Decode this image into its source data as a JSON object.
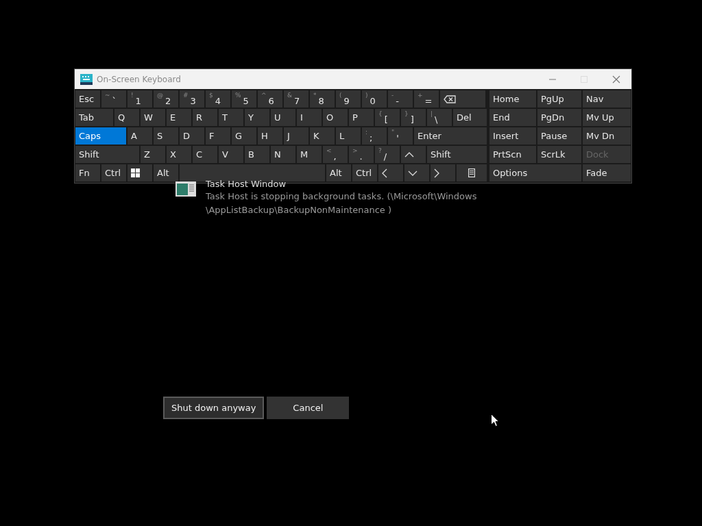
{
  "keyboard_window": {
    "title": "On-Screen Keyboard",
    "maximize_disabled": true,
    "rows": [
      {
        "keys": [
          {
            "kind": "text",
            "label": "Esc",
            "on": false
          },
          {
            "kind": "dual",
            "shift": "~",
            "label": "`",
            "on": false
          },
          {
            "kind": "dual",
            "shift": "!",
            "label": "1",
            "on": false
          },
          {
            "kind": "dual",
            "shift": "@",
            "label": "2",
            "on": false
          },
          {
            "kind": "dual",
            "shift": "#",
            "label": "3",
            "on": false
          },
          {
            "kind": "dual",
            "shift": "$",
            "label": "4",
            "on": false
          },
          {
            "kind": "dual",
            "shift": "%",
            "label": "5",
            "on": false
          },
          {
            "kind": "dual",
            "shift": "^",
            "label": "6",
            "on": false
          },
          {
            "kind": "dual",
            "shift": "&",
            "label": "7",
            "on": false
          },
          {
            "kind": "dual",
            "shift": "*",
            "label": "8",
            "on": false
          },
          {
            "kind": "dual",
            "shift": "(",
            "label": "9",
            "on": false
          },
          {
            "kind": "dual",
            "shift": ")",
            "label": "0",
            "on": false
          },
          {
            "kind": "dual",
            "shift": "-",
            "label": "-",
            "on": false
          },
          {
            "kind": "dual",
            "shift": "+",
            "label": "=",
            "on": false
          },
          {
            "kind": "backspace",
            "on": false
          }
        ]
      },
      {
        "keys": [
          {
            "kind": "text",
            "label": "Tab",
            "on": false
          },
          {
            "kind": "text",
            "label": "Q",
            "on": false
          },
          {
            "kind": "text",
            "label": "W",
            "on": false
          },
          {
            "kind": "text",
            "label": "E",
            "on": false
          },
          {
            "kind": "text",
            "label": "R",
            "on": false
          },
          {
            "kind": "text",
            "label": "T",
            "on": false
          },
          {
            "kind": "text",
            "label": "Y",
            "on": false
          },
          {
            "kind": "text",
            "label": "U",
            "on": false
          },
          {
            "kind": "text",
            "label": "I",
            "on": false
          },
          {
            "kind": "text",
            "label": "O",
            "on": false
          },
          {
            "kind": "text",
            "label": "P",
            "on": false
          },
          {
            "kind": "dual",
            "shift": "{",
            "label": "[",
            "on": false
          },
          {
            "kind": "dual",
            "shift": "}",
            "label": "]",
            "on": false
          },
          {
            "kind": "dual",
            "shift": "|",
            "label": "\\",
            "on": false
          },
          {
            "kind": "text",
            "label": "Del",
            "on": false
          }
        ]
      },
      {
        "keys": [
          {
            "kind": "text",
            "label": "Caps",
            "on": true
          },
          {
            "kind": "text",
            "label": "A",
            "on": false
          },
          {
            "kind": "text",
            "label": "S",
            "on": false
          },
          {
            "kind": "text",
            "label": "D",
            "on": false
          },
          {
            "kind": "text",
            "label": "F",
            "on": false
          },
          {
            "kind": "text",
            "label": "G",
            "on": false
          },
          {
            "kind": "text",
            "label": "H",
            "on": false
          },
          {
            "kind": "text",
            "label": "J",
            "on": false
          },
          {
            "kind": "text",
            "label": "K",
            "on": false
          },
          {
            "kind": "text",
            "label": "L",
            "on": false
          },
          {
            "kind": "dual",
            "shift": ":",
            "label": ";",
            "on": false
          },
          {
            "kind": "dual",
            "shift": "\"",
            "label": "'",
            "on": false
          },
          {
            "kind": "text",
            "label": "Enter",
            "on": false
          }
        ]
      },
      {
        "keys": [
          {
            "kind": "text",
            "label": "Shift",
            "on": false
          },
          {
            "kind": "text",
            "label": "Z",
            "on": false
          },
          {
            "kind": "text",
            "label": "X",
            "on": false
          },
          {
            "kind": "text",
            "label": "C",
            "on": false
          },
          {
            "kind": "text",
            "label": "V",
            "on": false
          },
          {
            "kind": "text",
            "label": "B",
            "on": false
          },
          {
            "kind": "text",
            "label": "N",
            "on": false
          },
          {
            "kind": "text",
            "label": "M",
            "on": false
          },
          {
            "kind": "dual",
            "shift": "<",
            "label": ",",
            "on": false
          },
          {
            "kind": "dual",
            "shift": ">",
            "label": ".",
            "on": false
          },
          {
            "kind": "dual",
            "shift": "?",
            "label": "/",
            "on": false
          },
          {
            "kind": "up",
            "on": false
          },
          {
            "kind": "text",
            "label": "Shift",
            "on": false
          }
        ]
      },
      {
        "keys": [
          {
            "kind": "text",
            "label": "Fn",
            "on": false
          },
          {
            "kind": "text",
            "label": "Ctrl",
            "on": false
          },
          {
            "kind": "windows",
            "on": false
          },
          {
            "kind": "text",
            "label": "Alt",
            "on": false
          },
          {
            "kind": "space",
            "on": false
          },
          {
            "kind": "text",
            "label": "Alt",
            "on": false
          },
          {
            "kind": "text",
            "label": "Ctrl",
            "on": false
          },
          {
            "kind": "left",
            "on": false
          },
          {
            "kind": "down",
            "on": false
          },
          {
            "kind": "right",
            "on": false
          },
          {
            "kind": "menu",
            "on": false
          }
        ]
      }
    ],
    "nav_rows": [
      [
        {
          "label": "Home",
          "disabled": false
        },
        {
          "label": "PgUp",
          "disabled": false
        },
        {
          "label": "Nav",
          "disabled": false
        }
      ],
      [
        {
          "label": "End",
          "disabled": false
        },
        {
          "label": "PgDn",
          "disabled": false
        },
        {
          "label": "Mv Up",
          "disabled": false
        }
      ],
      [
        {
          "label": "Insert",
          "disabled": false
        },
        {
          "label": "Pause",
          "disabled": false
        },
        {
          "label": "Mv Dn",
          "disabled": false
        }
      ],
      [
        {
          "label": "PrtScn",
          "disabled": false
        },
        {
          "label": "ScrLk",
          "disabled": false
        },
        {
          "label": "Dock",
          "disabled": true
        }
      ],
      [
        {
          "label": "Options",
          "disabled": false
        },
        {
          "label": "Fade",
          "disabled": false
        }
      ]
    ]
  },
  "task": {
    "title": "Task Host Window",
    "description": "Task Host is stopping background tasks. (\\Microsoft\\Windows \\AppListBackup\\BackupNonMaintenance )"
  },
  "buttons": [
    {
      "label": "Shut down anyway",
      "focused": true
    },
    {
      "label": "Cancel",
      "focused": false
    }
  ]
}
